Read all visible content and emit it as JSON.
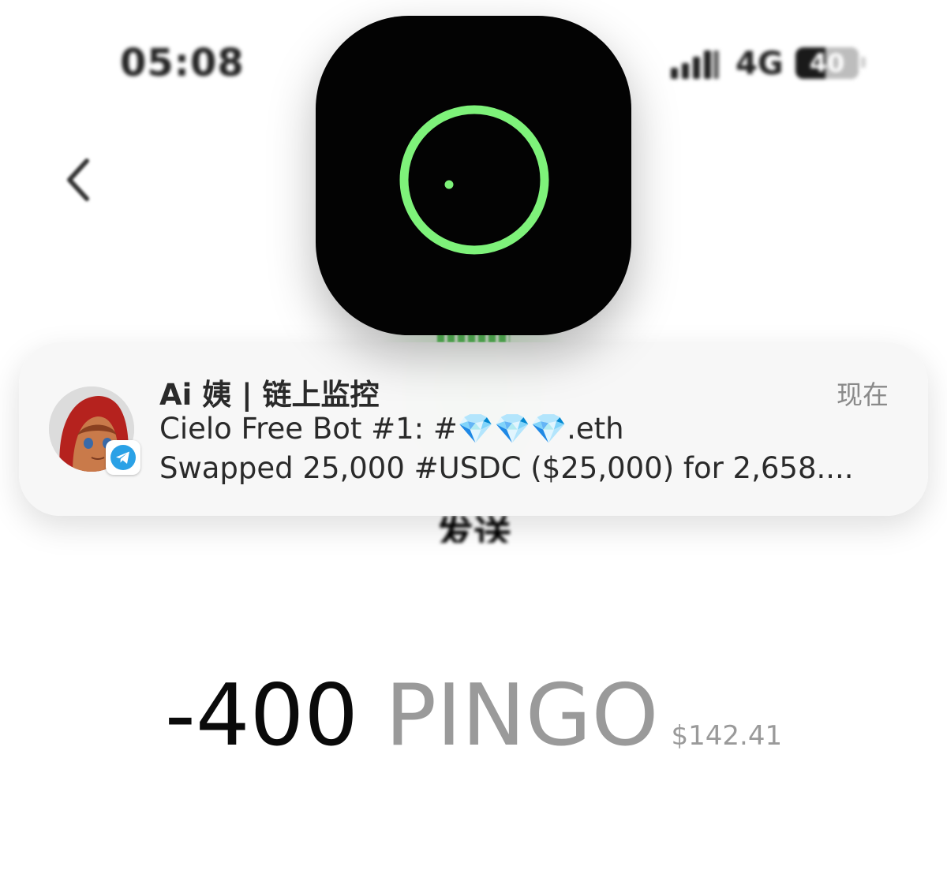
{
  "status_bar": {
    "time": "05:08",
    "network": "4G",
    "battery": "40",
    "icons": [
      "signal-icon",
      "battery-icon"
    ]
  },
  "header": {
    "back_icon": "chevron-left-icon",
    "obscured_title": "发送"
  },
  "overlay_app": {
    "icon": "ring-icon",
    "accent_color": "#7ef27a"
  },
  "notification": {
    "sender": "Ai 姨 | 链上监控",
    "time": "现在",
    "line1": "Cielo Free Bot #1: #💎💎💎.eth",
    "line2": "Swapped 25,000 #USDC ($25,000) for 2,658....",
    "app_badge_icon": "telegram-icon",
    "badge_color": "#2aa1e6"
  },
  "transaction": {
    "amount": "-400",
    "token": "PINGO",
    "usd_value": "$142.41"
  }
}
